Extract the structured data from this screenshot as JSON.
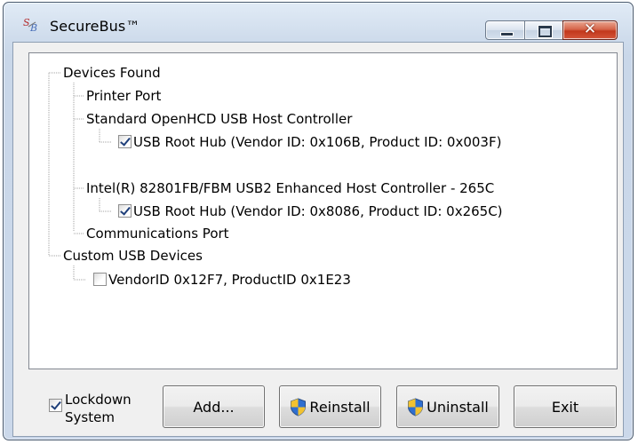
{
  "window": {
    "title": "SecureBus™",
    "icon": "securebus-app-icon",
    "controls": [
      "minimize-icon",
      "maximize-icon",
      "close-icon"
    ],
    "close_glyph": "✕"
  },
  "tree": {
    "root1": {
      "label": "Devices Found",
      "children": {
        "printer": {
          "label": "Printer Port"
        },
        "ohcd": {
          "label": "Standard OpenHCD USB Host Controller",
          "hub": {
            "label": "USB Root Hub (Vendor ID: 0x106B, Product ID: 0x003F)",
            "checked": true
          }
        },
        "intel": {
          "label": "Intel(R) 82801FB/FBM USB2 Enhanced Host Controller - 265C",
          "hub": {
            "label": "USB Root Hub (Vendor ID: 0x8086, Product ID: 0x265C)",
            "checked": true
          }
        },
        "comms": {
          "label": "Communications Port"
        }
      }
    },
    "root2": {
      "label": "Custom USB Devices",
      "children": {
        "custom1": {
          "label": "VendorID 0x12F7, ProductID 0x1E23",
          "checked": false
        }
      }
    }
  },
  "lockdown": {
    "label_line1": "Lockdown",
    "label_line2": "System",
    "checked": true
  },
  "buttons": {
    "add": "Add...",
    "reinstall": "Reinstall",
    "uninstall": "Uninstall",
    "exit": "Exit"
  },
  "colors": {
    "title_bar": "#cfdcec",
    "close_button": "#c2381c",
    "check_mark": "#1f3f7a",
    "shield_blue": "#2f6fd0",
    "shield_yellow": "#f2c230"
  }
}
